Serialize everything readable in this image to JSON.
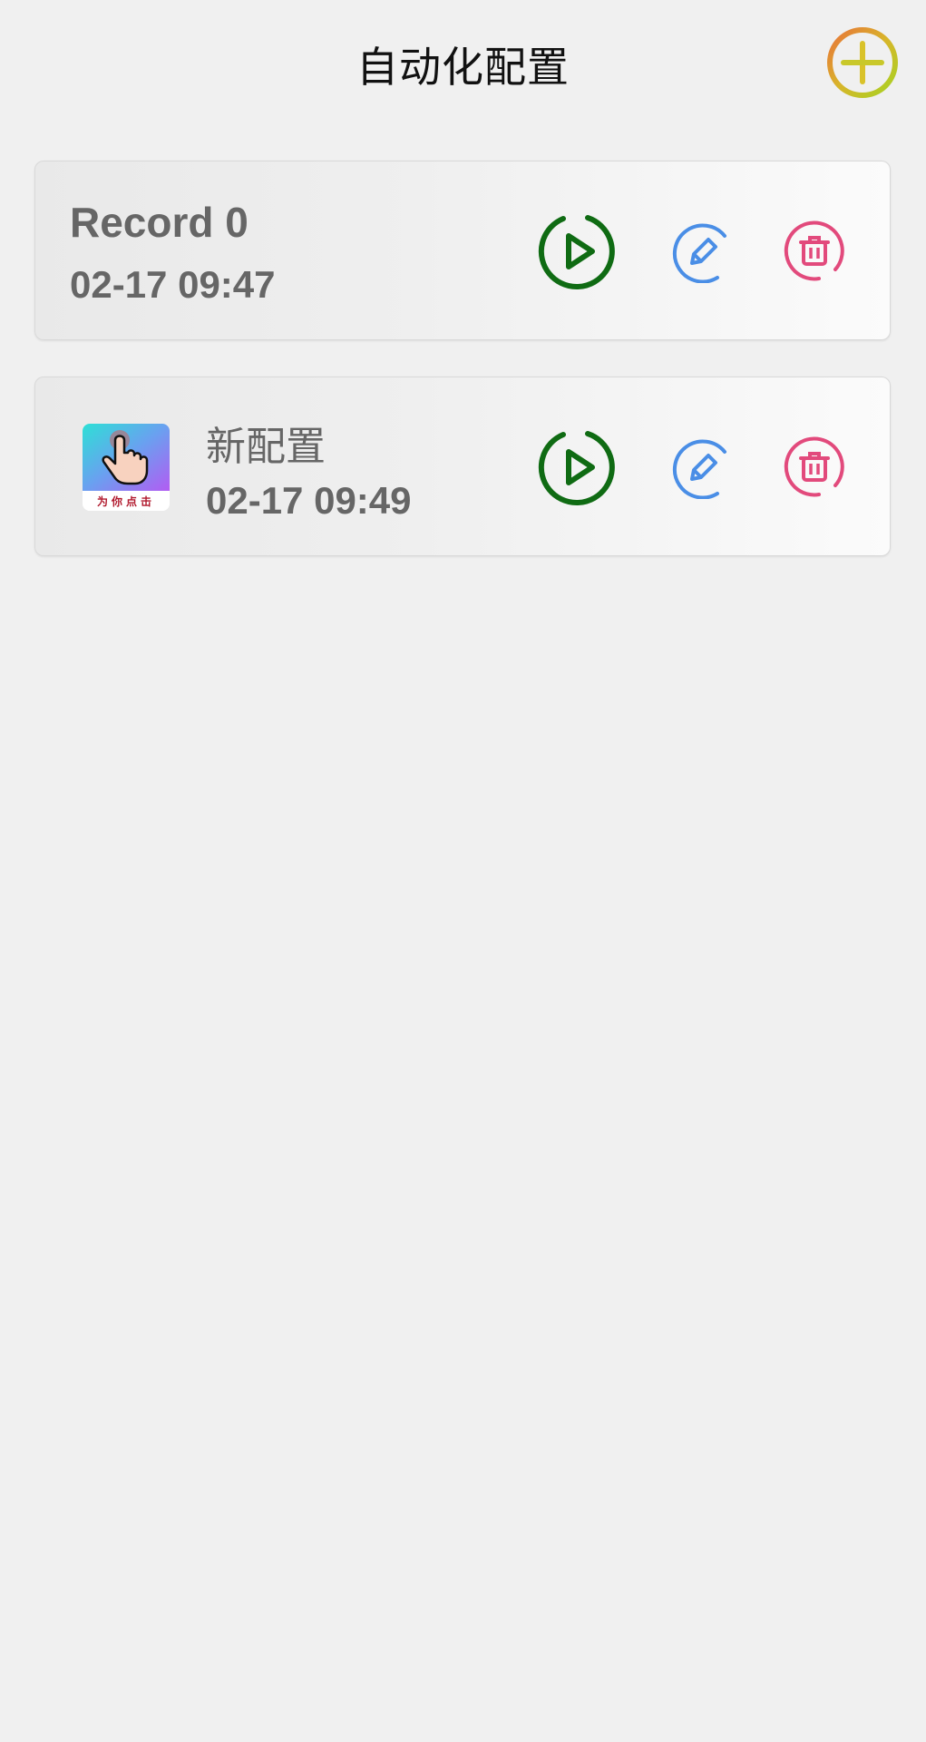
{
  "header": {
    "title": "自动化配置",
    "add_icon": "add-circle-icon"
  },
  "records": [
    {
      "name": "Record 0",
      "date": "02-17 09:47",
      "has_thumbnail": false
    },
    {
      "name": "新配置",
      "date": "02-17 09:49",
      "has_thumbnail": true,
      "thumbnail_caption": "为你点击"
    }
  ],
  "actions": {
    "play_icon": "play-circle-icon",
    "edit_icon": "edit-pencil-icon",
    "delete_icon": "trash-icon"
  },
  "colors": {
    "background": "#f0f0f0",
    "play": "#0f6b13",
    "edit": "#4a8ee6",
    "delete": "#e24a7c",
    "add_gradient_start": "#e8733a",
    "add_gradient_end": "#a6d323",
    "text": "#666666"
  }
}
